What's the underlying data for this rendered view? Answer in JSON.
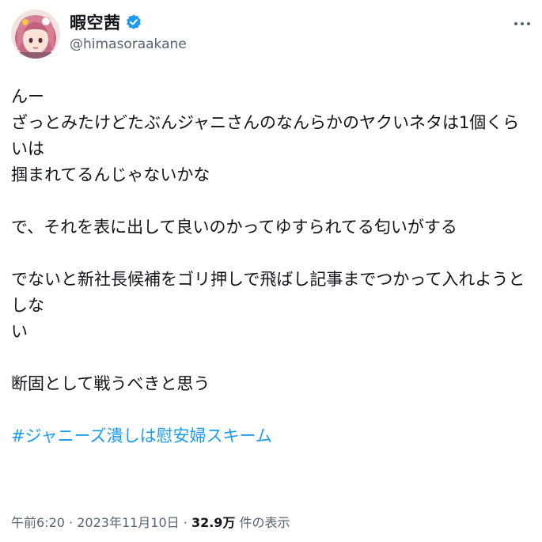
{
  "author": {
    "display_name": "暇空茜",
    "handle": "@himasoraakane",
    "verified_icon": "verified-badge-icon",
    "avatar_icon": "anime-avatar-icon"
  },
  "more_icon": "more-options-icon",
  "tweet": {
    "lines": [
      "んー",
      "ざっとみたけどたぶんジャニさんのなんらかのヤクいネタは1個くらいは",
      "掴まれてるんじゃないかな",
      "",
      "で、それを表に出して良いのかってゆすられてる匂いがする",
      "",
      "でないと新社長候補をゴリ押しで飛ばし記事までつかって入れようとしな",
      "い",
      "",
      "断固として戦うべきと思う",
      ""
    ],
    "hashtag": "#ジャニーズ潰しは慰安婦スキーム"
  },
  "meta": {
    "time": "午前6:20",
    "separator": "·",
    "date": "2023年11月10日",
    "views_count": "32.9万",
    "views_label": "件の表示"
  },
  "colors": {
    "text": "#0f1419",
    "secondary": "#536471",
    "link": "#1d9bf0",
    "verified": "#1d9bf0"
  }
}
